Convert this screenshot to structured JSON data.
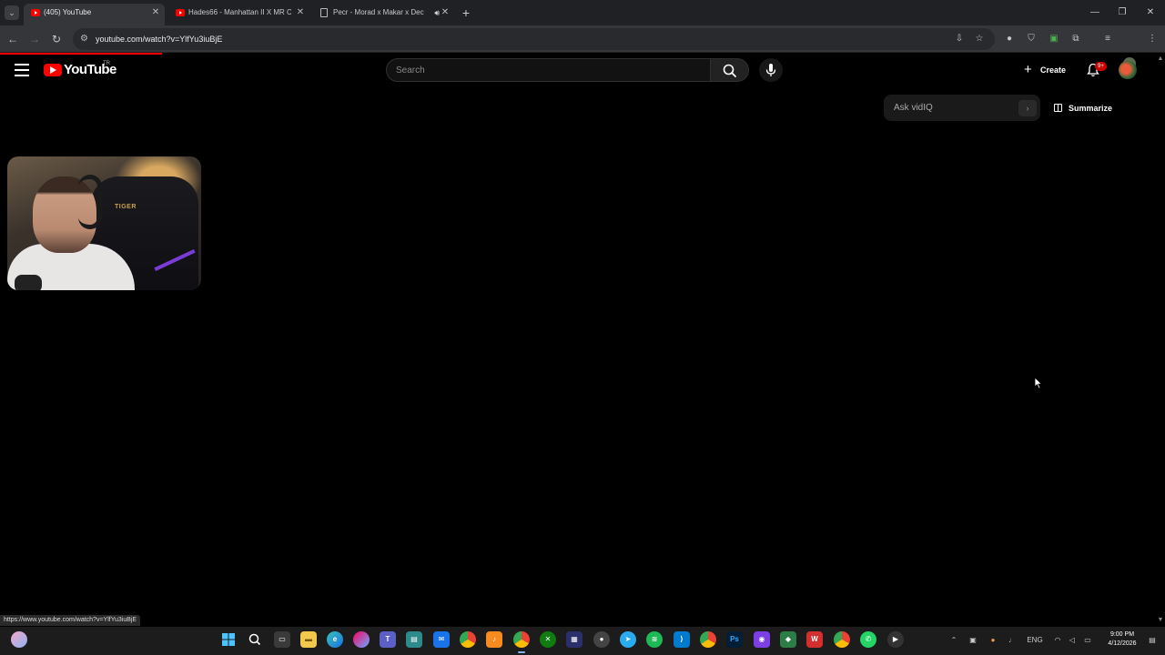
{
  "browser": {
    "tabs": [
      {
        "label": "(405) YouTube",
        "active": true
      },
      {
        "label": "Hades66 - Manhattan II X MR C",
        "active": false
      },
      {
        "label": "Pecr - Morad x Makar x Dec",
        "active": false
      }
    ],
    "url": "youtube.com/watch?v=YlfYu3iuBjE",
    "status_url": "https://www.youtube.com/watch?v=YlfYu3iuBjE"
  },
  "youtube": {
    "logo_text": "YouTube",
    "region": "TR",
    "search_placeholder": "Search",
    "create_label": "Create",
    "notification_badge": "9+"
  },
  "vidiq": {
    "ask_placeholder": "Ask vidIQ",
    "summarize_label": "Summarize"
  },
  "webcam": {
    "chair_brand": "TIGER"
  },
  "taskbar": {
    "language": "ENG",
    "time": "9:00 PM",
    "date": "4/12/2026"
  },
  "colors": {
    "brand_red": "#ff0000",
    "background": "#000000"
  }
}
